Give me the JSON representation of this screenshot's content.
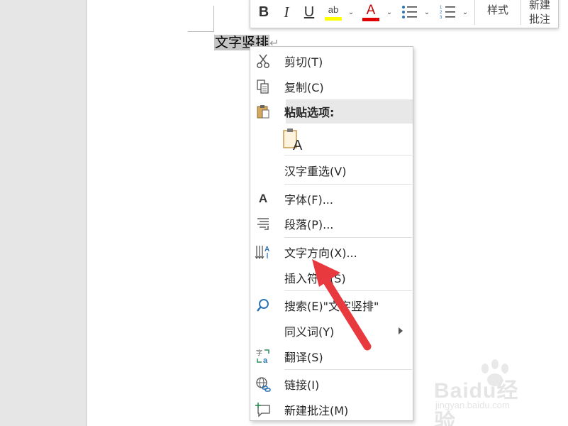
{
  "document": {
    "selected_text": "文字竖排",
    "para_mark": "↵"
  },
  "mini_toolbar": {
    "bold": "B",
    "italic": "I",
    "underline": "U",
    "highlight_glyph": "ab",
    "font_color_glyph": "A",
    "caret": "⌄",
    "styles_label": "样式",
    "new_comment_line1": "新建",
    "new_comment_line2": "批注",
    "highlight_color": "#ffff00",
    "font_color": "#e00000"
  },
  "context_menu": {
    "cut": "剪切(T)",
    "copy": "复制(C)",
    "paste_options": "粘贴选项:",
    "paste_option_letter": "A",
    "hanzi_reselect": "汉字重选(V)",
    "font": "字体(F)...",
    "paragraph": "段落(P)...",
    "text_direction": "文字方向(X)...",
    "insert_symbol": "插入符号(S)",
    "search": "搜索(E)\"文字竖排\"",
    "synonyms": "同义词(Y)",
    "translate": "翻译(S)",
    "link": "链接(I)",
    "new_comment": "新建批注(M)"
  },
  "colors": {
    "annotation_arrow": "#e8393f"
  },
  "watermark": {
    "text": "Baidu经验",
    "sub": "jingyan.baidu.com"
  }
}
